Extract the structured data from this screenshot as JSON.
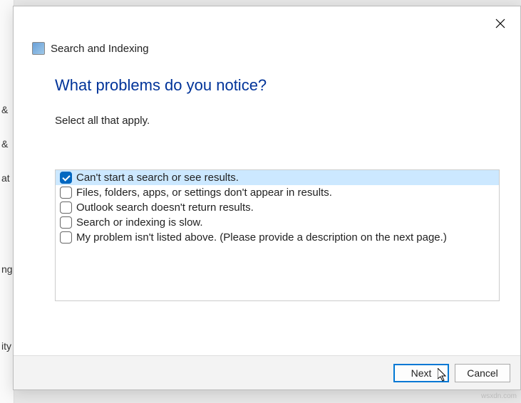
{
  "header": {
    "title": "Search and Indexing"
  },
  "main": {
    "heading": "What problems do you notice?",
    "subtext": "Select all that apply."
  },
  "options": [
    {
      "label": "Can't start a search or see results.",
      "checked": true
    },
    {
      "label": "Files, folders, apps, or settings don't appear in results.",
      "checked": false
    },
    {
      "label": "Outlook search doesn't return results.",
      "checked": false
    },
    {
      "label": "Search or indexing is slow.",
      "checked": false
    },
    {
      "label": "My problem isn't listed above. (Please provide a description on the next page.)",
      "checked": false
    }
  ],
  "footer": {
    "next": "Next",
    "cancel": "Cancel"
  },
  "watermark": "wsxdn.com"
}
